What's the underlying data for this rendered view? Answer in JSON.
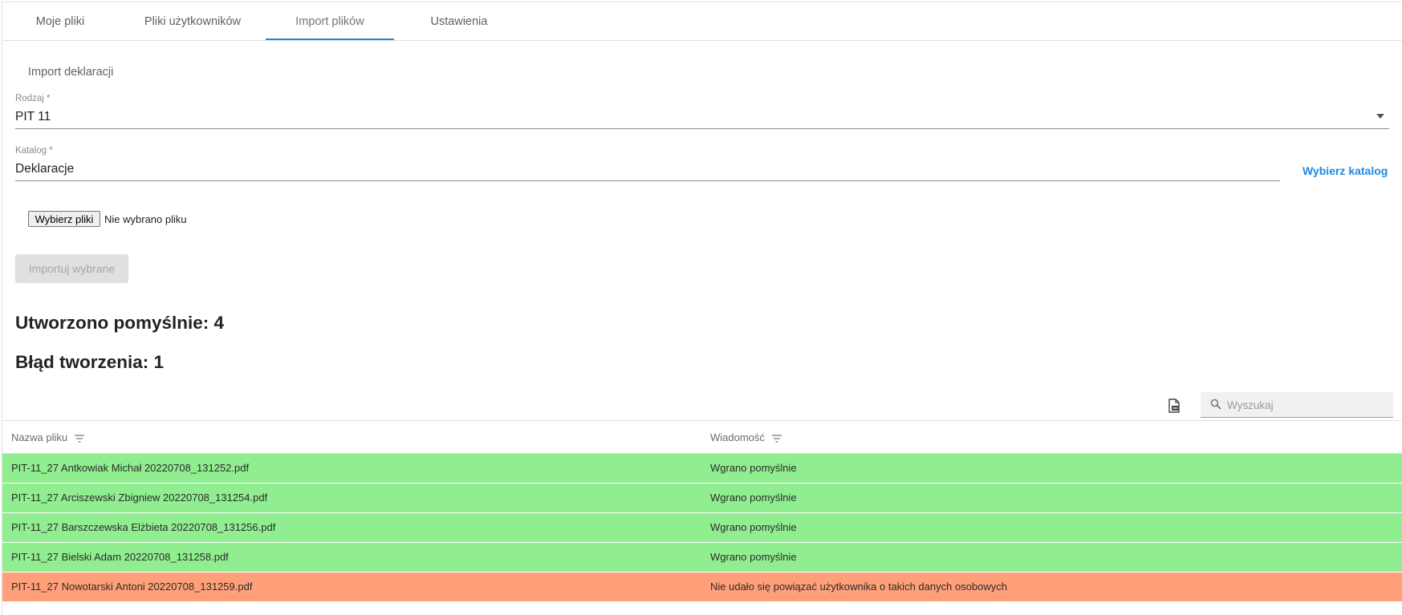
{
  "tabs": [
    {
      "label": "Moje pliki"
    },
    {
      "label": "Pliki użytkowników"
    },
    {
      "label": "Import plików"
    },
    {
      "label": "Ustawienia"
    }
  ],
  "active_tab": "Import plików",
  "section_title": "Import deklaracji",
  "rodzaj": {
    "label": "Rodzaj *",
    "value": "PIT 11"
  },
  "katalog": {
    "label": "Katalog *",
    "value": "Deklaracje",
    "button": "Wybierz katalog"
  },
  "file_input": {
    "button": "Wybierz pliki",
    "status": "Nie wybrano pliku"
  },
  "import_button": "Importuj wybrane",
  "summary": {
    "success": "Utworzono pomyślnie: 4",
    "error": "Błąd tworzenia: 1"
  },
  "search": {
    "placeholder": "Wyszukaj",
    "value": ""
  },
  "table": {
    "columns": [
      "Nazwa pliku",
      "Wiadomość"
    ],
    "rows": [
      {
        "file": "PIT-11_27 Antkowiak Michał 20220708_131252.pdf",
        "message": "Wgrano pomyślnie",
        "status": "success"
      },
      {
        "file": "PIT-11_27 Arciszewski Zbigniew 20220708_131254.pdf",
        "message": "Wgrano pomyślnie",
        "status": "success"
      },
      {
        "file": "PIT-11_27 Barszczewska Elżbieta 20220708_131256.pdf",
        "message": "Wgrano pomyślnie",
        "status": "success"
      },
      {
        "file": "PIT-11_27 Bielski Adam 20220708_131258.pdf",
        "message": "Wgrano pomyślnie",
        "status": "success"
      },
      {
        "file": "PIT-11_27 Nowotarski Antoni 20220708_131259.pdf",
        "message": "Nie udało się powiązać użytkownika o takich danych osobowych",
        "status": "error"
      }
    ]
  },
  "colors": {
    "accent": "#1e88e5",
    "row_success": "#90ee90",
    "row_error": "#ffa07a"
  },
  "icons": {
    "export": "export-icon",
    "search": "search-icon",
    "filter": "filter-icon",
    "dropdown": "chevron-down-icon"
  }
}
